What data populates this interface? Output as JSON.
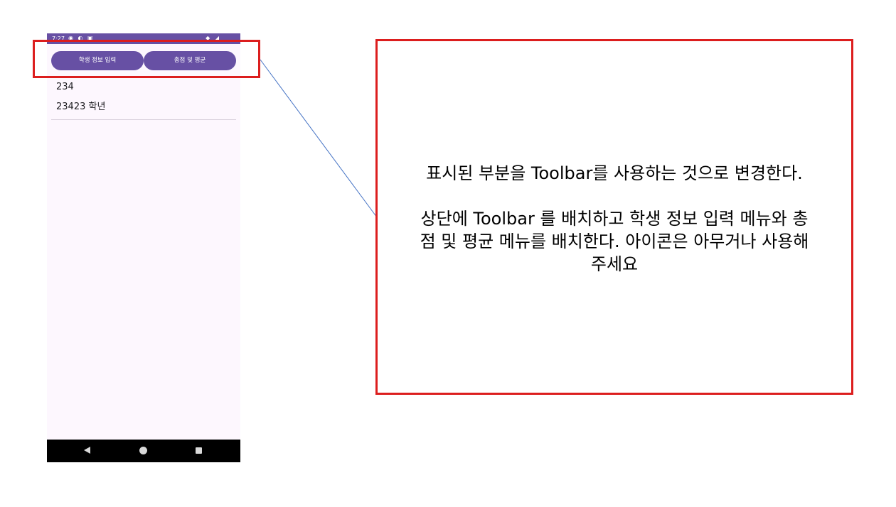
{
  "phone": {
    "status": {
      "time": "7:27",
      "left_icons": "◉ ◐ ▣",
      "right_icons": "◆ ◢"
    },
    "buttons": {
      "student_info": "학생 정보 입력",
      "total_average": "총점 및 평균"
    },
    "list": {
      "line1": "234",
      "line2": "23423 학년"
    },
    "nav": [
      "back",
      "home",
      "recents"
    ]
  },
  "annotation": {
    "line1": "표시된 부분을 Toolbar를 사용하는 것으로 변경한다.",
    "para1": "상단에 Toolbar 를 배치하고 학생 정보 입력 메뉴와 총",
    "para2": "점 및 평균 메뉴를 배치한다. 아이콘은 아무거나 사용해",
    "para3": "주세요"
  },
  "colors": {
    "primary": "#6750a4",
    "highlight": "#dc1e1e",
    "connector": "#4472c4",
    "surface": "#fdf7fe"
  }
}
